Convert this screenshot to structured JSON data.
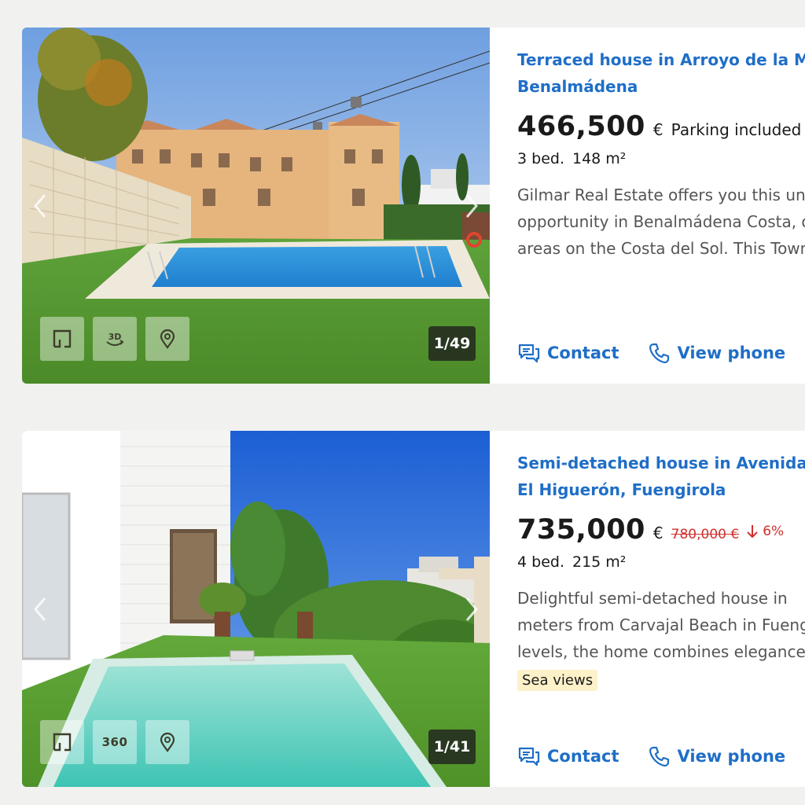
{
  "listings": [
    {
      "title_line1": "Terraced house in Arroyo de la Miel",
      "title_line2": "Benalmádena",
      "price": "466,500",
      "currency": "€",
      "extra": "Parking included",
      "beds": "3 bed.",
      "area": "148 m²",
      "description_lines": [
        "Gilmar Real Estate offers you this unique",
        "opportunity in Benalmádena Costa, one of the best",
        "areas on the Costa del Sol. This Townhouse"
      ],
      "photo_counter": "1/49",
      "tools": [
        "floor-plan",
        "3D",
        "map"
      ],
      "contact_label": "Contact",
      "phone_label": "View phone"
    },
    {
      "title_line1": "Semi-detached house in Avenida",
      "title_line2": "El Higuerón, Fuengirola",
      "price": "735,000",
      "currency": "€",
      "old_price": "780,000 €",
      "price_drop": "6%",
      "beds": "4 bed.",
      "area": "215 m²",
      "description_lines": [
        "Delightful semi-detached house in",
        "meters from Carvajal Beach in Fuengirola",
        "levels, the home combines elegance"
      ],
      "tag": "Sea views",
      "photo_counter": "1/41",
      "tools": [
        "floor-plan",
        "360",
        "map"
      ],
      "contact_label": "Contact",
      "phone_label": "View phone"
    }
  ],
  "colors": {
    "link": "#1f6ec7",
    "price_drop": "#d0312d",
    "tag_bg": "#fdf1c9",
    "page_bg": "#f1f1f0"
  }
}
